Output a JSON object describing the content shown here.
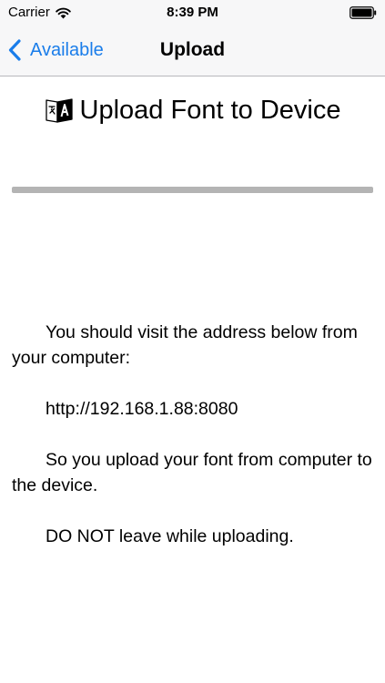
{
  "status_bar": {
    "carrier": "Carrier",
    "time": "8:39 PM",
    "wifi_icon": "wifi-icon",
    "battery_icon": "battery-full-icon"
  },
  "nav": {
    "back_label": "Available",
    "back_icon": "chevron-left-icon",
    "title": "Upload"
  },
  "page": {
    "title": "Upload Font to Device",
    "title_icon": "font-translate-icon"
  },
  "progress": {
    "fraction": 0
  },
  "instructions": {
    "line1": "You should visit the address below from your computer:",
    "url": "http://192.168.1.88:8080",
    "line2": "So you upload your font from computer to the device.",
    "line3": "DO NOT leave while uploading."
  },
  "colors": {
    "accent": "#1a7dea",
    "header_bg": "#f7f7f8",
    "progress_track": "#b4b4b4"
  }
}
